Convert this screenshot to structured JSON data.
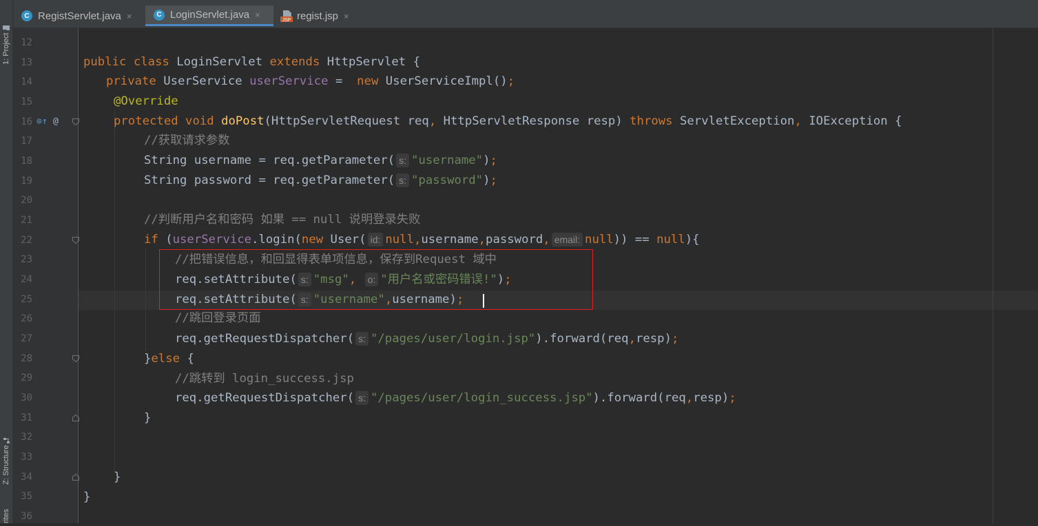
{
  "side_panel": {
    "project_label": "1: Project",
    "structure_label": "Z: Structure",
    "favorites_label": "rites"
  },
  "tabs": [
    {
      "icon": "C",
      "label": "RegistServlet.java",
      "close": "×",
      "active": false
    },
    {
      "icon": "C",
      "label": "LoginServlet.java",
      "close": "×",
      "active": true
    },
    {
      "icon": "JSP",
      "label": "regist.jsp",
      "close": "×",
      "active": false
    }
  ],
  "gutter": {
    "line_numbers": [
      "12",
      "13",
      "14",
      "15",
      "16",
      "17",
      "18",
      "19",
      "20",
      "21",
      "22",
      "23",
      "24",
      "25",
      "26",
      "27",
      "28",
      "29",
      "30",
      "31",
      "32",
      "33",
      "34",
      "35",
      "36"
    ],
    "override_marker": "⊙↑",
    "annotation_marker": "@"
  },
  "code": {
    "l13": {
      "kw1": "public class ",
      "name": "LoginServlet ",
      "kw2": "extends ",
      "rest": "HttpServlet {"
    },
    "l14": {
      "kw1": "private ",
      "type": "UserService ",
      "field": "userService",
      "eq": " =  ",
      "kw2": "new ",
      "rest": "UserServiceImpl()",
      "semi": ";"
    },
    "l15": {
      "annotation": "@Override"
    },
    "l16": {
      "kw1": "protected void ",
      "method": "doPost",
      "p1": "(HttpServletRequest req",
      "c1": ", ",
      "p2": "HttpServletResponse resp) ",
      "kw2": "throws ",
      "p3": "ServletException",
      "c2": ", ",
      "p4": "IOException {"
    },
    "l17": {
      "comment": "//获取请求参数"
    },
    "l18": {
      "pre": "String username = req.getParameter(",
      "hint": "s:",
      "str": "\"username\"",
      "post": ")",
      "semi": ";"
    },
    "l19": {
      "pre": "String password = req.getParameter(",
      "hint": "s:",
      "str": "\"password\"",
      "post": ")",
      "semi": ";"
    },
    "l21": {
      "comment": "//判断用户名和密码 如果 == null 说明登录失败"
    },
    "l22": {
      "kw1": "if ",
      "p1": "(",
      "field": "userService",
      "p2": ".login(",
      "kw2": "new ",
      "p3": "User(",
      "hint1": "id:",
      "kw3": "null",
      "c1": ",",
      "p4": "username",
      "c2": ",",
      "p5": "password",
      "c3": ",",
      "hint2": "email:",
      "kw4": "null",
      "p6": ")) == ",
      "kw5": "null",
      "p7": "){"
    },
    "l23": {
      "comment": "//把错误信息，和回显得表单项信息，保存到Request 域中"
    },
    "l24": {
      "pre": "req.setAttribute(",
      "hint1": "s:",
      "str1": "\"msg\"",
      "c1": ", ",
      "hint2": "o:",
      "str2": "\"用户名或密码错误!\"",
      "post": ")",
      "semi": ";"
    },
    "l25": {
      "pre": "req.setAttribute(",
      "hint": "s:",
      "str": "\"username\"",
      "c1": ",",
      "post": "username)",
      "semi": ";"
    },
    "l26": {
      "comment": "//跳回登录页面"
    },
    "l27": {
      "pre": "req.getRequestDispatcher(",
      "hint": "s:",
      "str": "\"/pages/user/login.jsp\"",
      "mid": ").forward(req",
      "c1": ",",
      "post": "resp)",
      "semi": ";"
    },
    "l28": {
      "p1": "}",
      "kw": "else ",
      "p2": "{"
    },
    "l29": {
      "comment": "//跳转到 login_success.jsp"
    },
    "l30": {
      "pre": "req.getRequestDispatcher(",
      "hint": "s:",
      "str": "\"/pages/user/login_success.jsp\"",
      "mid": ").forward(req",
      "c1": ",",
      "post": "resp)",
      "semi": ";"
    },
    "l31": {
      "p": "}"
    },
    "l34": {
      "p": "}"
    },
    "l35": {
      "p": "}"
    }
  },
  "colors": {
    "background": "#2b2b2b",
    "keyword": "#cc7832",
    "string": "#6a8759",
    "comment": "#808080",
    "field": "#9876aa",
    "method": "#ffc66d",
    "annotation": "#bbb529",
    "highlight_box": "#e02020"
  }
}
